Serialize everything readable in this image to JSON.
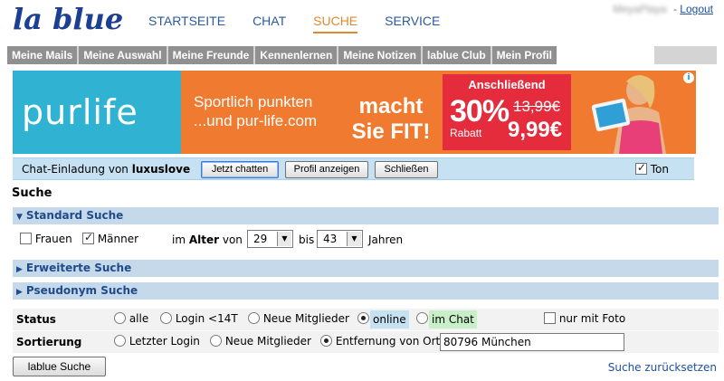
{
  "header": {
    "logo_text": "la blue",
    "nav": [
      {
        "label": "STARTSEITE",
        "active": false
      },
      {
        "label": "CHAT",
        "active": false
      },
      {
        "label": "SUCHE",
        "active": true
      },
      {
        "label": "SERVICE",
        "active": false
      }
    ],
    "username": "MeyaPlaya",
    "separator": "-",
    "logout": "Logout"
  },
  "menu": [
    "Meine Mails",
    "Meine Auswahl",
    "Meine Freunde",
    "Kennenlernen",
    "Meine Notizen",
    "lablue Club",
    "Mein Profil"
  ],
  "banner": {
    "brand": "purlife",
    "slogan_line1": "Sportlich punkten",
    "slogan_line2": "...und pur-life.com",
    "slogan_big": "macht Sie FIT!",
    "offer_title": "Anschließend",
    "discount": "30%",
    "discount_label": "Rabatt",
    "old_price": "13,99€",
    "new_price": "9,99€"
  },
  "invite": {
    "prefix": "Chat-Einladung von ",
    "user": "luxuslove",
    "btn_chat": "Jetzt chatten",
    "btn_profile": "Profil anzeigen",
    "btn_close": "Schließen",
    "sound_label": "Ton",
    "sound_checked": true
  },
  "search": {
    "title": "Suche",
    "standard_title": "Standard Suche",
    "women_label": "Frauen",
    "women_checked": false,
    "men_label": "Männer",
    "men_checked": true,
    "age_prefix": "im ",
    "age_bold": "Alter",
    "age_from_label": " von",
    "age_from": "29",
    "age_to_label": "bis",
    "age_to": "43",
    "age_suffix": "Jahren",
    "advanced_title": "Erweiterte Suche",
    "pseudonym_title": "Pseudonym Suche"
  },
  "status": {
    "label": "Status",
    "options": [
      "alle",
      "Login <14T",
      "Neue Mitglieder",
      "online",
      "im Chat"
    ],
    "selected": "online",
    "photo_label": "nur mit Foto",
    "photo_checked": false
  },
  "sort": {
    "label": "Sortierung",
    "options": [
      "Letzter Login",
      "Neue Mitglieder",
      "Entfernung von Ort"
    ],
    "selected": "Entfernung von Ort",
    "location_value": "80796 München"
  },
  "actions": {
    "search_button": "lablue Suche",
    "reset_link": "Suche zurücksetzen"
  },
  "colors": {
    "nav_blue": "#2b5a9a",
    "nav_active": "#e08a2e",
    "menu_grey": "#909090",
    "section_bg": "#c5d9ea",
    "invite_bg": "#c6e1f2"
  }
}
